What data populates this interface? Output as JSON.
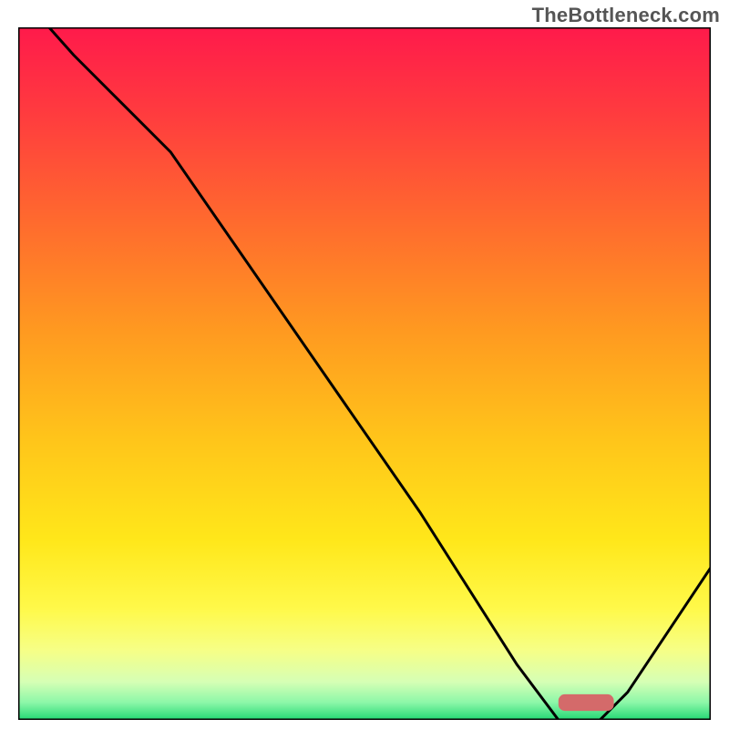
{
  "watermark": "TheBottleneck.com",
  "colors": {
    "marker": "#d46a6a",
    "gradient_stops": [
      {
        "offset": 0.0,
        "color": "#ff1a4b"
      },
      {
        "offset": 0.12,
        "color": "#ff3a3f"
      },
      {
        "offset": 0.28,
        "color": "#ff6a2e"
      },
      {
        "offset": 0.44,
        "color": "#ff9a20"
      },
      {
        "offset": 0.6,
        "color": "#ffc61a"
      },
      {
        "offset": 0.74,
        "color": "#ffe71a"
      },
      {
        "offset": 0.84,
        "color": "#fff94a"
      },
      {
        "offset": 0.9,
        "color": "#f6ff87"
      },
      {
        "offset": 0.945,
        "color": "#d6ffb5"
      },
      {
        "offset": 0.975,
        "color": "#8cf7a8"
      },
      {
        "offset": 1.0,
        "color": "#23d874"
      }
    ]
  },
  "chart_data": {
    "type": "line",
    "title": "",
    "xlabel": "",
    "ylabel": "",
    "xlim": [
      0,
      100
    ],
    "ylim": [
      0,
      100
    ],
    "series": [
      {
        "name": "bottleneck-curve",
        "x": [
          0,
          8,
          22,
          40,
          58,
          72,
          78,
          84,
          88,
          100
        ],
        "y": [
          105,
          96,
          82,
          56,
          30,
          8,
          0,
          0,
          4,
          22
        ]
      }
    ],
    "marker": {
      "x_start": 78,
      "x_end": 86,
      "y": 1.3,
      "height": 2.4
    }
  }
}
